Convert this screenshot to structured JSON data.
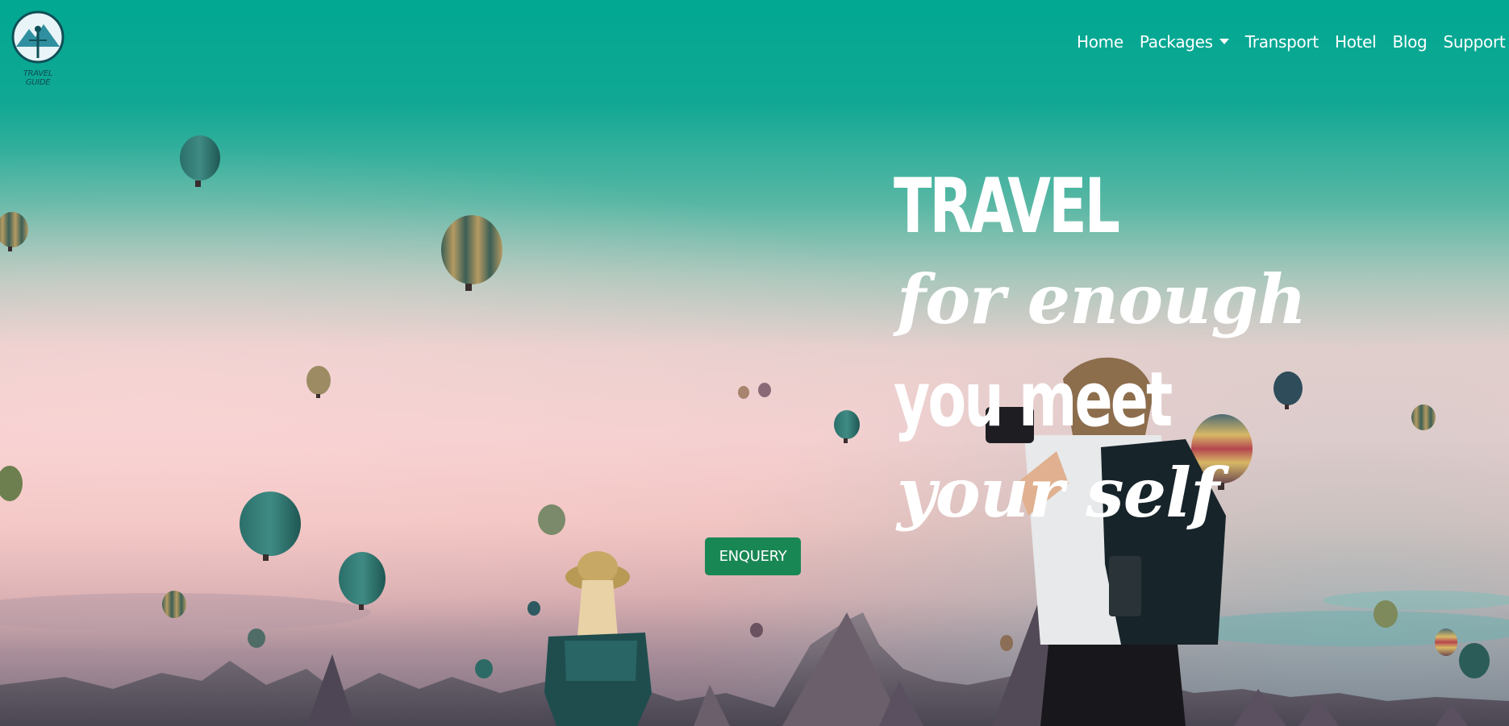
{
  "logo": {
    "text": "TRAVEL GUIDE"
  },
  "nav": {
    "home": "Home",
    "packages": "Packages",
    "transport": "Transport",
    "hotel": "Hotel",
    "blog": "Blog",
    "support": "Support"
  },
  "hero": {
    "line1": "TRAVEL",
    "line2": "for enough",
    "line3": "you meet",
    "line4": "your self",
    "cta": "ENQUERY"
  },
  "colors": {
    "sky_top": "#01a892",
    "sky_bottom": "#f3cfcf",
    "button": "#198754",
    "text": "#ffffff"
  }
}
